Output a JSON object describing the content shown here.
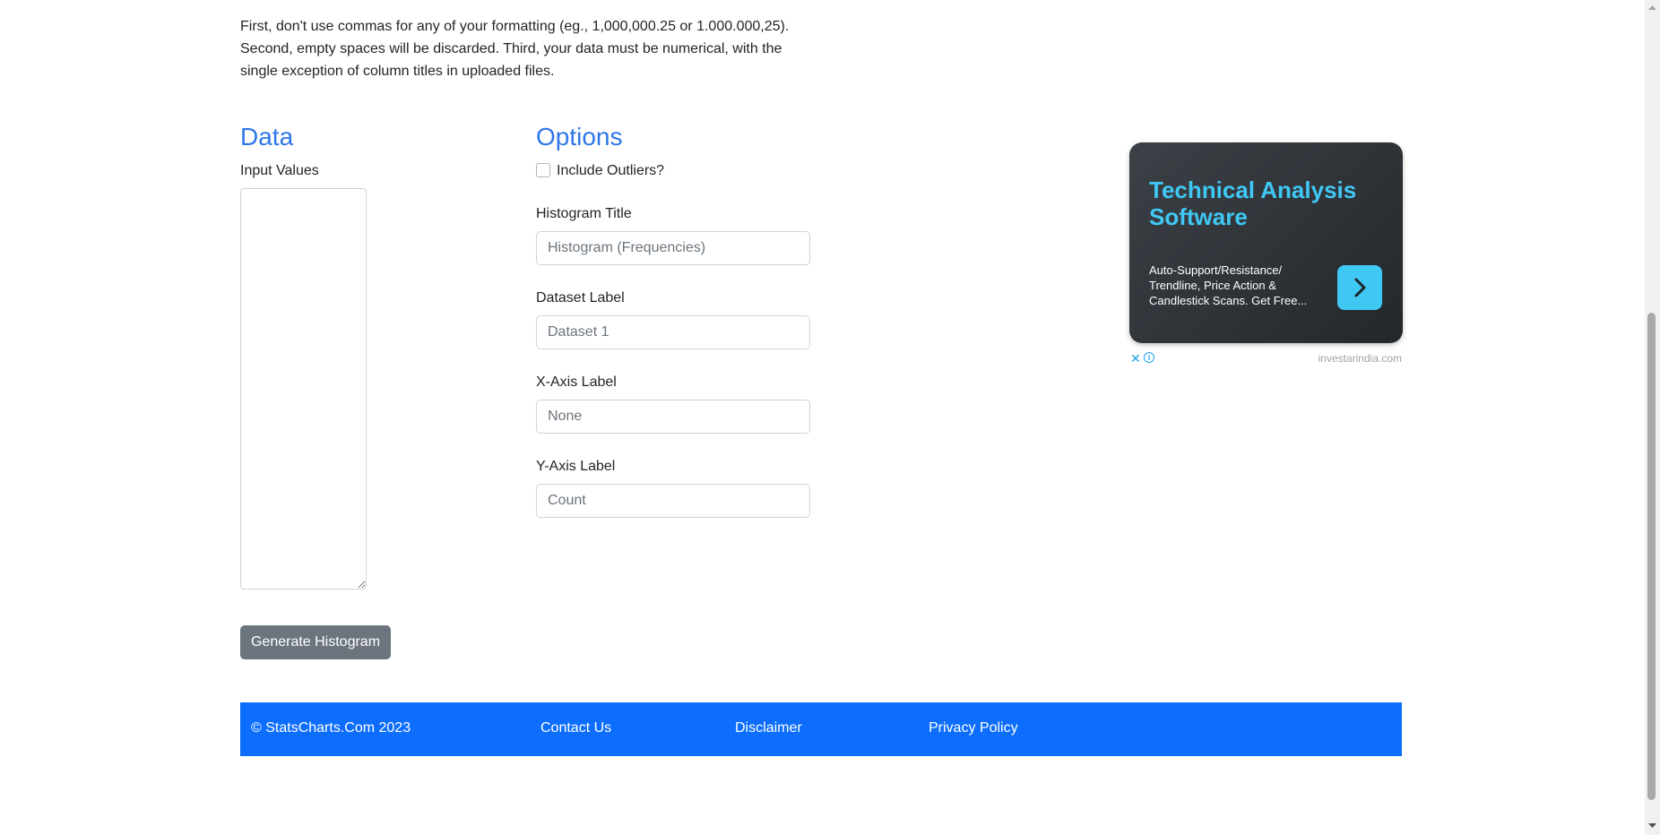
{
  "intro": {
    "text": "First, don't use commas for any of your formatting (eg., 1,000,000.25 or 1.000.000,25). Second, empty spaces will be discarded. Third, your data must be numerical, with the single exception of column titles in uploaded files."
  },
  "data_section": {
    "title": "Data",
    "input_label": "Input Values",
    "input_value": ""
  },
  "options_section": {
    "title": "Options",
    "outliers_label": "Include Outliers?",
    "outliers_checked": false,
    "histogram_title": {
      "label": "Histogram Title",
      "placeholder": "Histogram (Frequencies)",
      "value": ""
    },
    "dataset_label": {
      "label": "Dataset Label",
      "placeholder": "Dataset 1",
      "value": ""
    },
    "x_axis_label": {
      "label": "X-Axis Label",
      "placeholder": "None",
      "value": ""
    },
    "y_axis_label": {
      "label": "Y-Axis Label",
      "placeholder": "Count",
      "value": ""
    }
  },
  "generate_button": {
    "label": "Generate Histogram"
  },
  "advertisement": {
    "title": "Technical Analysis Software",
    "description": "Auto-Support/Resistance/ Trendline, Price Action & Candlestick Scans. Get Free...",
    "domain": "investarindia.com",
    "close_glyph": "✕",
    "info_glyph": "i",
    "arrow_icon": "chevron-right-icon",
    "accent_color": "#3fc8f4",
    "background_color": "#2c3035"
  },
  "footer": {
    "copyright": "© StatsCharts.Com 2023",
    "contact": "Contact Us",
    "disclaimer": "Disclaimer",
    "privacy": "Privacy Policy",
    "background_color": "#0d6efd"
  },
  "colors": {
    "heading": "#2f76e8",
    "button_secondary": "#6c757d"
  }
}
